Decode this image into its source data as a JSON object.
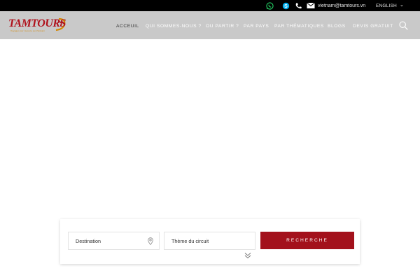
{
  "topbar": {
    "email": "vietnam@tamtours.vn",
    "language": "ENGLISH",
    "icons": [
      "whatsapp-icon",
      "skype-icon",
      "phone-icon",
      "envelope-icon",
      "chevron-down-icon"
    ]
  },
  "header": {
    "logo_text": "TAMTOURS",
    "logo_tagline": "Voyages sur mesure au Vietnam",
    "menu": [
      {
        "label": "ACCEUIL",
        "active": true
      },
      {
        "label": "QUI SOMMES-NOUS ?"
      },
      {
        "label": "OU PARTIR ?"
      },
      {
        "label": "PAR PAYS"
      },
      {
        "label": "PAR THÉMATIQUES"
      },
      {
        "label": "BLOGS"
      },
      {
        "label": "DEVIS GRATUIT"
      }
    ]
  },
  "search_form": {
    "destination_placeholder": "Destination",
    "theme_placeholder": "Thème du circuit",
    "button_label": "RECHERCHE"
  },
  "colors": {
    "topbar": "#000000",
    "navbar": "#c9c9c9",
    "accent": "#a3111c",
    "whatsapp": "#25d366",
    "skype": "#00aff0"
  }
}
